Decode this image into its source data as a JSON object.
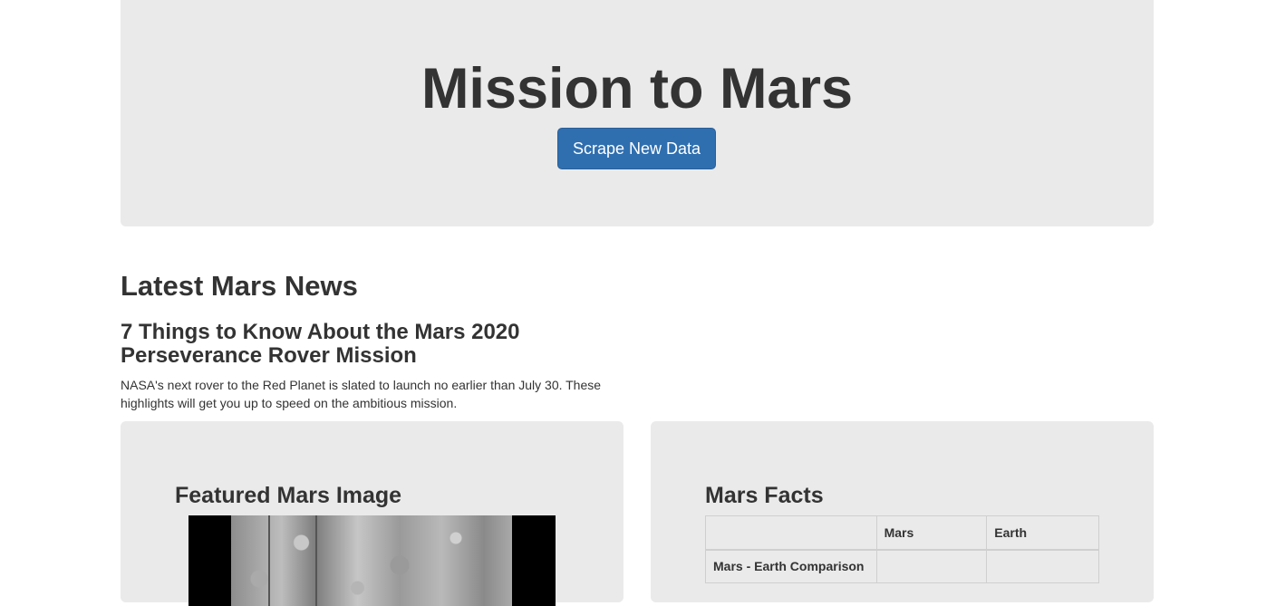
{
  "header": {
    "title": "Mission to Mars",
    "scrape_button_label": "Scrape New Data"
  },
  "news": {
    "section_heading": "Latest Mars News",
    "article_title": "7 Things to Know About the Mars 2020 Perseverance Rover Mission",
    "article_teaser": "NASA's next rover to the Red Planet is slated to launch no earlier than July 30. These highlights will get you up to speed on the ambitious mission."
  },
  "featured_image": {
    "heading": "Featured Mars Image"
  },
  "facts": {
    "heading": "Mars Facts",
    "columns": [
      "",
      "Mars",
      "Earth"
    ],
    "rows": [
      [
        "Mars - Earth Comparison",
        "",
        ""
      ]
    ]
  },
  "colors": {
    "jumbotron_bg": "#eaeaea",
    "button_bg": "#2f6fb0",
    "text": "#333333"
  }
}
